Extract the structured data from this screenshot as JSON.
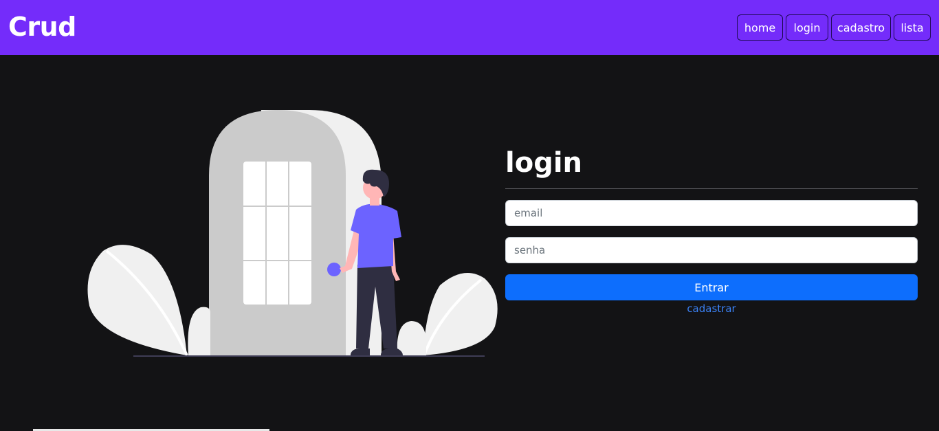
{
  "navbar": {
    "brand": "Crud",
    "links": [
      {
        "label": "home"
      },
      {
        "label": "login"
      },
      {
        "label": "cadastro"
      },
      {
        "label": "lista"
      }
    ]
  },
  "form": {
    "title": "login",
    "email_placeholder": "email",
    "password_placeholder": "senha",
    "submit_label": "Entrar",
    "register_link": "cadastrar"
  },
  "colors": {
    "navbar": "#742cfa",
    "background": "#131315",
    "primary_button": "#0d6efd",
    "link": "#3b82f6",
    "figure_shirt": "#6c63ff"
  },
  "illustration": {
    "description_icon": "person-at-door-illustration"
  }
}
